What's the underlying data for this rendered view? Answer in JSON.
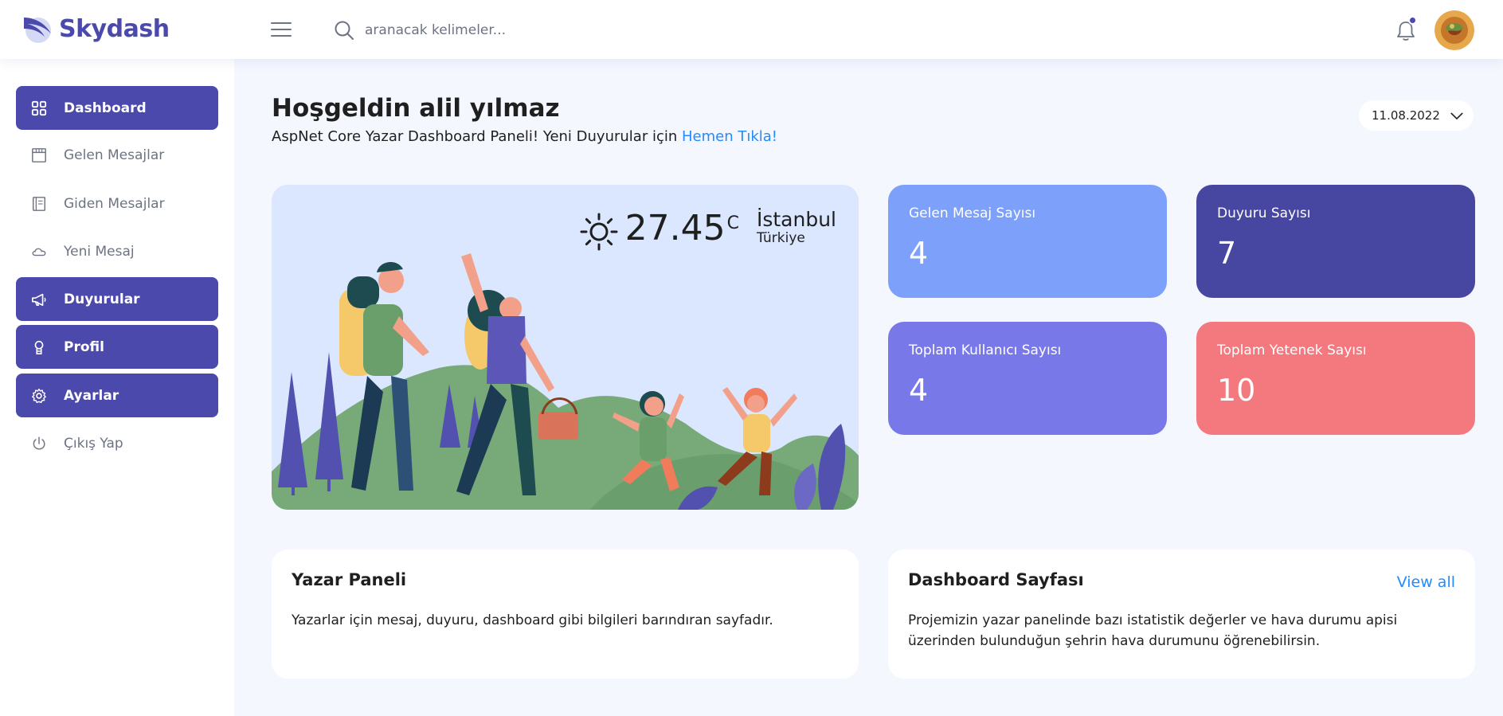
{
  "brand": {
    "name": "Skydash"
  },
  "search": {
    "placeholder": "aranacak kelimeler..."
  },
  "sidebar": {
    "items": [
      {
        "label": "Dashboard",
        "icon": "grid-icon",
        "active": true
      },
      {
        "label": "Gelen Mesajlar",
        "icon": "calendar-icon",
        "active": false
      },
      {
        "label": "Giden Mesajlar",
        "icon": "notebook-icon",
        "active": false
      },
      {
        "label": "Yeni Mesaj",
        "icon": "cloud-icon",
        "active": false
      },
      {
        "label": "Duyurular",
        "icon": "megaphone-icon",
        "active": true
      },
      {
        "label": "Profil",
        "icon": "user-icon",
        "active": true
      },
      {
        "label": "Ayarlar",
        "icon": "gear-icon",
        "active": true
      },
      {
        "label": "Çıkış Yap",
        "icon": "power-icon",
        "active": false
      }
    ]
  },
  "header": {
    "title": "Hoşgeldin alil yılmaz",
    "subtitle_text": "AspNet Core Yazar Dashboard Paneli! Yeni Duyurular için",
    "subtitle_link": "Hemen Tıkla!",
    "date": "11.08.2022"
  },
  "weather": {
    "temperature": "27.45",
    "unit": "C",
    "city": "İstanbul",
    "country": "Türkiye"
  },
  "stats": [
    {
      "label": "Gelen Mesaj Sayısı",
      "value": "4",
      "color": "#7da0fa"
    },
    {
      "label": "Duyuru Sayısı",
      "value": "7",
      "color": "#4747a1"
    },
    {
      "label": "Toplam Kullanıcı Sayısı",
      "value": "4",
      "color": "#7978e9"
    },
    {
      "label": "Toplam Yetenek Sayısı",
      "value": "10",
      "color": "#f3797e"
    }
  ],
  "cards": {
    "yazar": {
      "title": "Yazar Paneli",
      "text": "Yazarlar için mesaj, duyuru, dashboard gibi bilgileri barındıran sayfadır."
    },
    "dashboard": {
      "title": "Dashboard Sayfası",
      "link": "View all",
      "text": "Projemizin yazar panelinde bazı istatistik değerler ve hava durumu apisi üzerinden bulunduğun şehrin hava durumunu öğrenebilirsin."
    }
  },
  "colors": {
    "primary": "#4b49ac",
    "link": "#248afd",
    "background": "#f5f7ff"
  }
}
